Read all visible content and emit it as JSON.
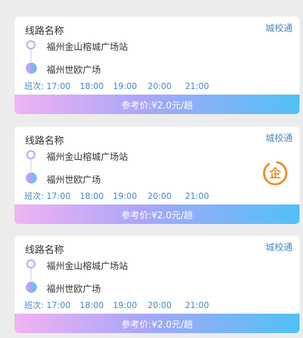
{
  "routes": [
    {
      "title": "线路名称",
      "tag": "城校通",
      "from": "福州金山榕城广场站",
      "to": "福州世欧广场",
      "schedule_label": "班次:",
      "times": [
        "17:00",
        "18:00",
        "19:00",
        "20:00",
        "21:00"
      ],
      "fare": "参考价:¥2.0元/趟",
      "badge": null
    },
    {
      "title": "线路名称",
      "tag": "城校通",
      "from": "福州金山榕城广场站",
      "to": "福州世欧广场",
      "schedule_label": "班次:",
      "times": [
        "17:00",
        "18:00",
        "19:00",
        "20:00",
        "21:00"
      ],
      "fare": "参考价:¥2.0元/趟",
      "badge": {
        "label": "企",
        "icon": "enterprise-badge-icon",
        "color": "#ef8a1e"
      }
    },
    {
      "title": "线路名称",
      "tag": "城校通",
      "from": "福州金山榕城广场站",
      "to": "福州世欧广场",
      "schedule_label": "班次:",
      "times": [
        "17:00",
        "18:00",
        "19:00",
        "20:00",
        "21:00"
      ],
      "fare": "参考价:¥2.0元/趟",
      "badge": null
    }
  ]
}
